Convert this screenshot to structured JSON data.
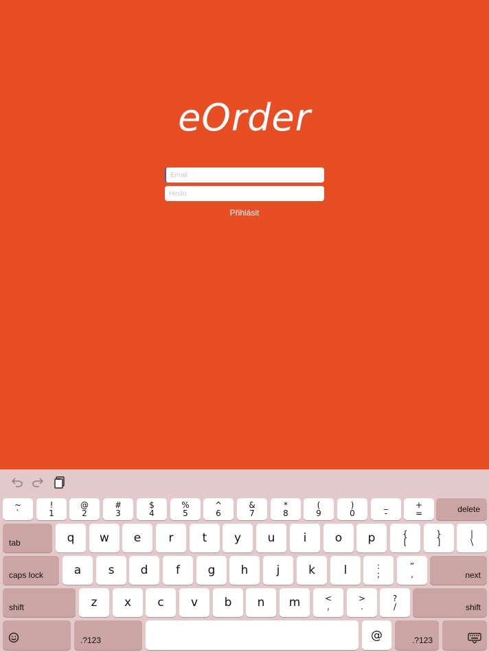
{
  "app": {
    "logo": "eOrder",
    "email_placeholder": "Email",
    "password_placeholder": "Heslo",
    "login_label": "Přihlásit"
  },
  "keyboard": {
    "toolbar": {
      "undo_icon": "undo-arrow-icon",
      "redo_icon": "redo-arrow-icon",
      "paste_icon": "clipboard-icon"
    },
    "number_row": [
      {
        "top": "~",
        "bottom": "`"
      },
      {
        "top": "!",
        "bottom": "1"
      },
      {
        "top": "@",
        "bottom": "2"
      },
      {
        "top": "#",
        "bottom": "3"
      },
      {
        "top": "$",
        "bottom": "4"
      },
      {
        "top": "%",
        "bottom": "5"
      },
      {
        "top": "^",
        "bottom": "6"
      },
      {
        "top": "&",
        "bottom": "7"
      },
      {
        "top": "*",
        "bottom": "8"
      },
      {
        "top": "(",
        "bottom": "9"
      },
      {
        "top": ")",
        "bottom": "0"
      },
      {
        "top": "_",
        "bottom": "-"
      },
      {
        "top": "+",
        "bottom": "="
      }
    ],
    "delete_label": "delete",
    "tab_label": "tab",
    "row_q": [
      "q",
      "w",
      "e",
      "r",
      "t",
      "y",
      "u",
      "i",
      "o",
      "p"
    ],
    "row_q_symbols": [
      {
        "top": "{",
        "bottom": "["
      },
      {
        "top": "}",
        "bottom": "]"
      },
      {
        "top": "|",
        "bottom": "\\"
      }
    ],
    "caps_lock_label": "caps lock",
    "row_a": [
      "a",
      "s",
      "d",
      "f",
      "g",
      "h",
      "j",
      "k",
      "l"
    ],
    "row_a_symbols": [
      {
        "top": ":",
        "bottom": ";"
      },
      {
        "top": "”",
        "bottom": ","
      }
    ],
    "next_label": "next",
    "shift_label": "shift",
    "row_z": [
      "z",
      "x",
      "c",
      "v",
      "b",
      "n",
      "m"
    ],
    "row_z_symbols": [
      {
        "top": "<",
        "bottom": ","
      },
      {
        "top": ">",
        "bottom": "."
      },
      {
        "top": "?",
        "bottom": "/"
      }
    ],
    "emoji_icon": "emoji-smiley-icon",
    "numbers_label": ".?123",
    "at_label": "@",
    "hide_keyboard_icon": "keyboard-dismiss-icon"
  },
  "colors": {
    "brand": "#E84E24",
    "keyboard_bg": "#E3C9C9",
    "function_key": "#CBA4A4"
  }
}
